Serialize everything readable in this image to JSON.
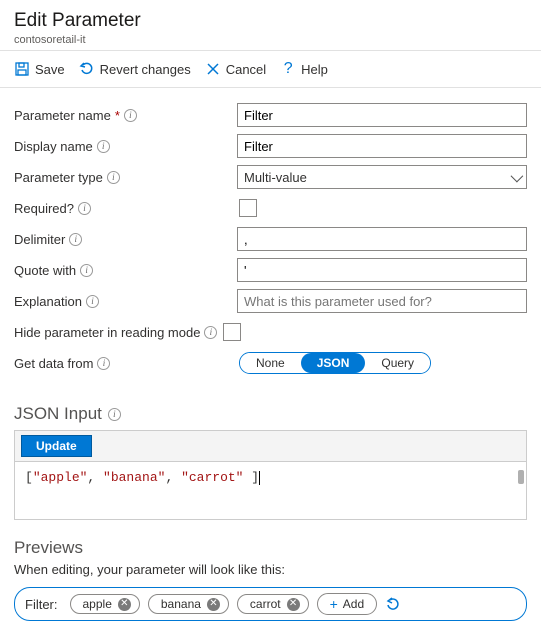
{
  "header": {
    "title": "Edit Parameter",
    "subtitle": "contosoretail-it"
  },
  "toolbar": {
    "save": "Save",
    "revert": "Revert changes",
    "cancel": "Cancel",
    "help": "Help"
  },
  "fields": {
    "paramName": {
      "label": "Parameter name",
      "value": "Filter"
    },
    "displayName": {
      "label": "Display name",
      "value": "Filter"
    },
    "paramType": {
      "label": "Parameter type",
      "value": "Multi-value"
    },
    "required": {
      "label": "Required?"
    },
    "delimiter": {
      "label": "Delimiter",
      "value": ","
    },
    "quoteWith": {
      "label": "Quote with",
      "value": "'"
    },
    "explanation": {
      "label": "Explanation",
      "placeholder": "What is this parameter used for?"
    },
    "hideInReading": {
      "label": "Hide parameter in reading mode"
    },
    "getDataFrom": {
      "label": "Get data from",
      "options": {
        "none": "None",
        "json": "JSON",
        "query": "Query"
      },
      "selected": "json"
    }
  },
  "jsonInput": {
    "heading": "JSON Input",
    "update": "Update",
    "tokens": {
      "b0": "[",
      "s0": "\"apple\"",
      "c0": ", ",
      "s1": "\"banana\"",
      "c1": ", ",
      "s2": "\"carrot\"",
      "b1": " ]"
    }
  },
  "previews": {
    "heading": "Previews",
    "subhead": "When editing, your parameter will look like this:",
    "label": "Filter:",
    "items": [
      "apple",
      "banana",
      "carrot"
    ],
    "add": "Add"
  }
}
